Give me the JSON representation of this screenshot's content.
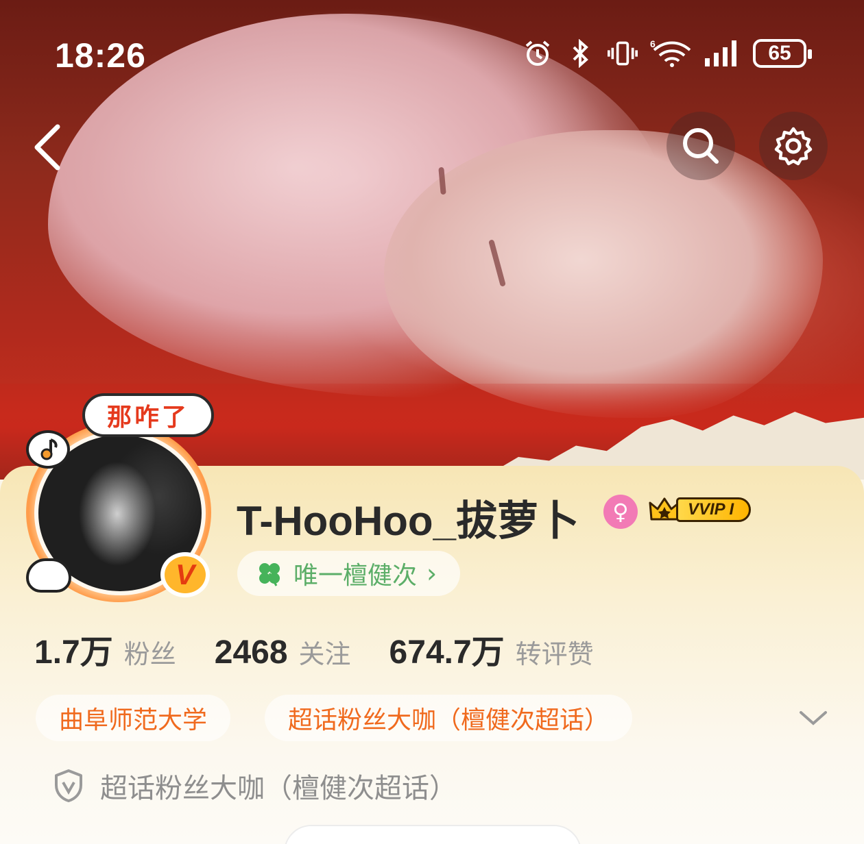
{
  "status_bar": {
    "time": "18:26",
    "battery": "65",
    "icons": [
      "alarm-icon",
      "bluetooth-icon",
      "vibrate-icon",
      "wifi-6-icon",
      "signal-icon",
      "battery-icon"
    ]
  },
  "nav": {
    "back_icon": "chevron-left-icon",
    "search_icon": "search-icon",
    "settings_icon": "gear-icon"
  },
  "profile": {
    "speech_bubble": "那咋了",
    "name": "T-HooHoo_拔萝卜",
    "vip_label": "VVIP I",
    "group": {
      "icon": "clover-icon",
      "label": "唯一檀健次",
      "arrow": "›"
    },
    "stats": [
      {
        "value": "1.7万",
        "label": "粉丝"
      },
      {
        "value": "2468",
        "label": "关注"
      },
      {
        "value": "674.7万",
        "label": "转评赞"
      }
    ],
    "tags": [
      "曲阜师范大学",
      "超话粉丝大咖（檀健次超话）"
    ],
    "certification": "超话粉丝大咖（檀健次超话）"
  },
  "colors": {
    "accent_orange": "#f06a1e",
    "green": "#5cae68",
    "gender_pink": "#f27ab5",
    "vip_gold": "#ffc21a"
  }
}
